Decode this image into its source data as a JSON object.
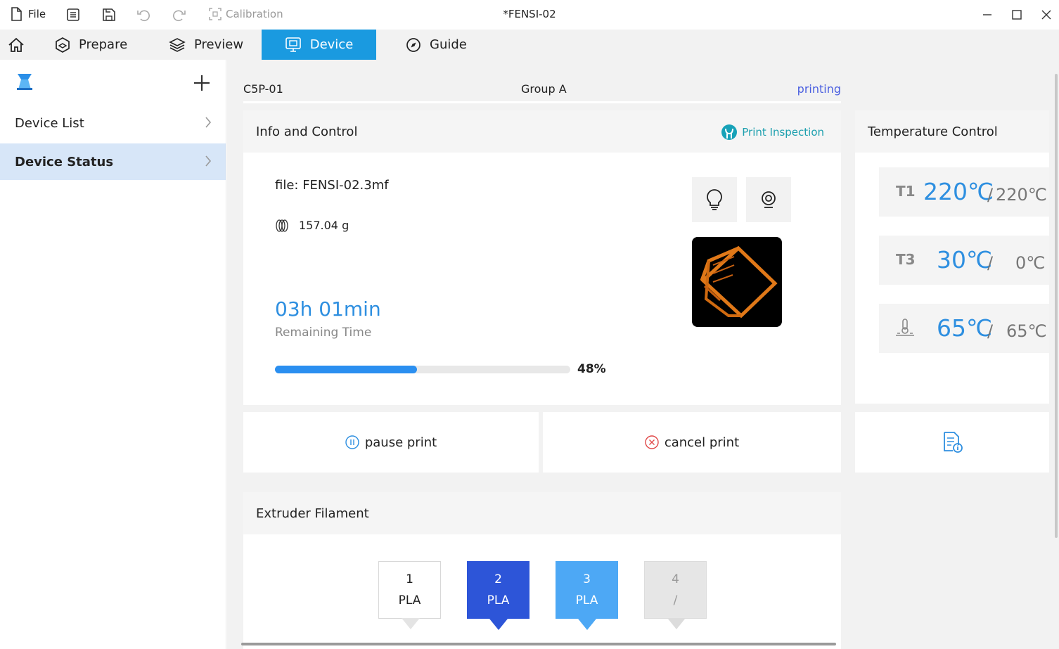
{
  "titlebar": {
    "file_label": "File",
    "calibration_label": "Calibration",
    "window_title": "*FENSI-02"
  },
  "menu": {
    "tabs": [
      {
        "label": "Prepare"
      },
      {
        "label": "Preview"
      },
      {
        "label": "Device"
      },
      {
        "label": "Guide"
      }
    ],
    "accent": "#1a9ae0"
  },
  "sidebar": {
    "items": [
      {
        "label": "Device List"
      },
      {
        "label": "Device Status"
      }
    ]
  },
  "device": {
    "name": "C5P-01",
    "group": "Group A",
    "status": "printing"
  },
  "info": {
    "title": "Info and Control",
    "inspection_label": "Print Inspection",
    "file": "file: FENSI-02.3mf",
    "weight": "157.04 g",
    "remaining": "03h 01min",
    "remaining_label": "Remaining Time",
    "progress": 48,
    "progress_label": "48%"
  },
  "temperature": {
    "title": "Temperature  Control",
    "cards": [
      {
        "label": "T1",
        "current": "220℃",
        "target": "220℃"
      },
      {
        "label": "T3",
        "current": "30℃",
        "target": "0℃"
      },
      {
        "label": "",
        "current": "65℃",
        "target": "65℃",
        "icon": "bed-temperature-icon"
      }
    ]
  },
  "actions": {
    "pause_label": "pause print",
    "cancel_label": "cancel print"
  },
  "filament": {
    "title": "Extruder  Filament",
    "slots": [
      {
        "index": "1",
        "material": "PLA",
        "color": "#ffffff"
      },
      {
        "index": "2",
        "material": "PLA",
        "color": "#2d55d8"
      },
      {
        "index": "3",
        "material": "PLA",
        "color": "#4da8f5"
      },
      {
        "index": "4",
        "material": "/",
        "color": "#e6e6e6"
      }
    ]
  }
}
